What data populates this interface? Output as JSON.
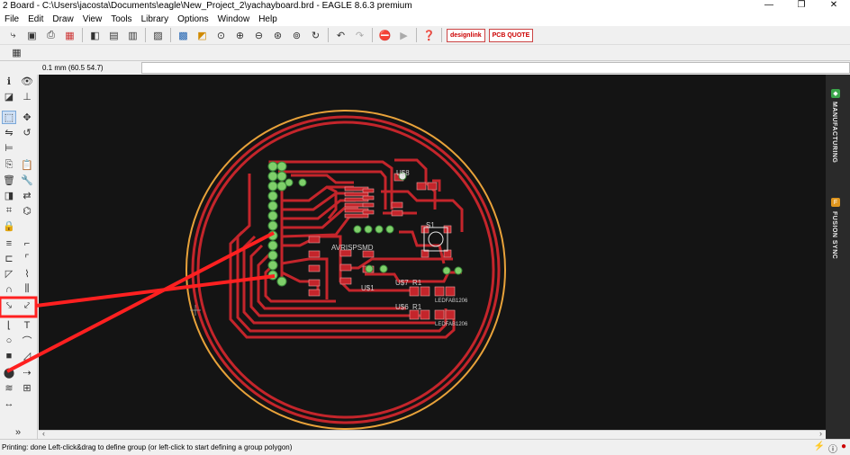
{
  "window": {
    "title": "2 Board - C:\\Users\\jacosta\\Documents\\eagle\\New_Project_2\\yachayboard.brd - EAGLE 8.6.3 premium",
    "minimize": "—",
    "restore": "❐",
    "close": "✕"
  },
  "menu": {
    "items": [
      "File",
      "Edit",
      "Draw",
      "View",
      "Tools",
      "Library",
      "Options",
      "Window",
      "Help"
    ]
  },
  "toolbar": {
    "designlink": "designlink",
    "pcbquote": "PCB QUOTE"
  },
  "coordbar": {
    "coord": "0.1 mm (60.5 54.7)",
    "command_value": ""
  },
  "board": {
    "labels": {
      "avrispsmd": "AVRISPSMD",
      "s1": "S1",
      "u8": "U$8",
      "u7": "U$7",
      "u6": "U$6",
      "r1a": "R1",
      "r1b": "R1",
      "ledfab1": "LEDFAB1206",
      "ledfab2": "LEDFAB1206",
      "us1": "U$1"
    }
  },
  "rightpanel": {
    "manufacturing": "MANUFACTURING",
    "fusion": "FUSION SYNC"
  },
  "status": {
    "message": "Printing: done Left-click&drag to define group (or left-click to start defining a group polygon)"
  },
  "colors": {
    "board_bg": "#141414",
    "trace": "#c4252b",
    "outline": "#e8a23a",
    "pad": "#7fcf6a",
    "annotation": "#ff2020"
  }
}
